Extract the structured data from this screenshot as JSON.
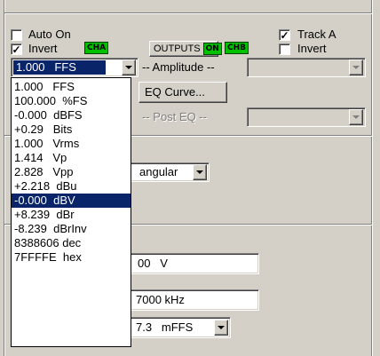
{
  "channel_a": {
    "auto_on_label": "Auto On",
    "auto_on_checked": false,
    "invert_label": "Invert",
    "invert_checked": true,
    "badge": "CHA"
  },
  "outputs": {
    "label": "OUTPUTS",
    "state": "ON"
  },
  "channel_b": {
    "badge": "CHB",
    "track_label": "Track A",
    "track_checked": true,
    "invert_label": "Invert",
    "invert_checked": false
  },
  "amplitude": {
    "selected": "1.000   FFS",
    "group_label": "-- Amplitude --",
    "options": [
      "1.000   FFS",
      "100.000  %FS",
      "-0.000  dBFS",
      "+0.29   Bits",
      "1.000   Vrms",
      "1.414   Vp",
      "2.828   Vpp",
      "+2.218  dBu",
      "-0.000  dBV",
      "+8.239  dBr",
      "-8.239  dBrInv",
      "8388606 dec",
      "7FFFFE  hex"
    ],
    "highlighted_index": 8
  },
  "eq": {
    "button_label": "EQ Curve...",
    "post_eq_label": "-- Post EQ --"
  },
  "waveform": {
    "visible_text": "angular"
  },
  "fields": {
    "value_1": "00   V",
    "value_2": "7000 kHz",
    "value_3": "7.3   mFFS"
  }
}
